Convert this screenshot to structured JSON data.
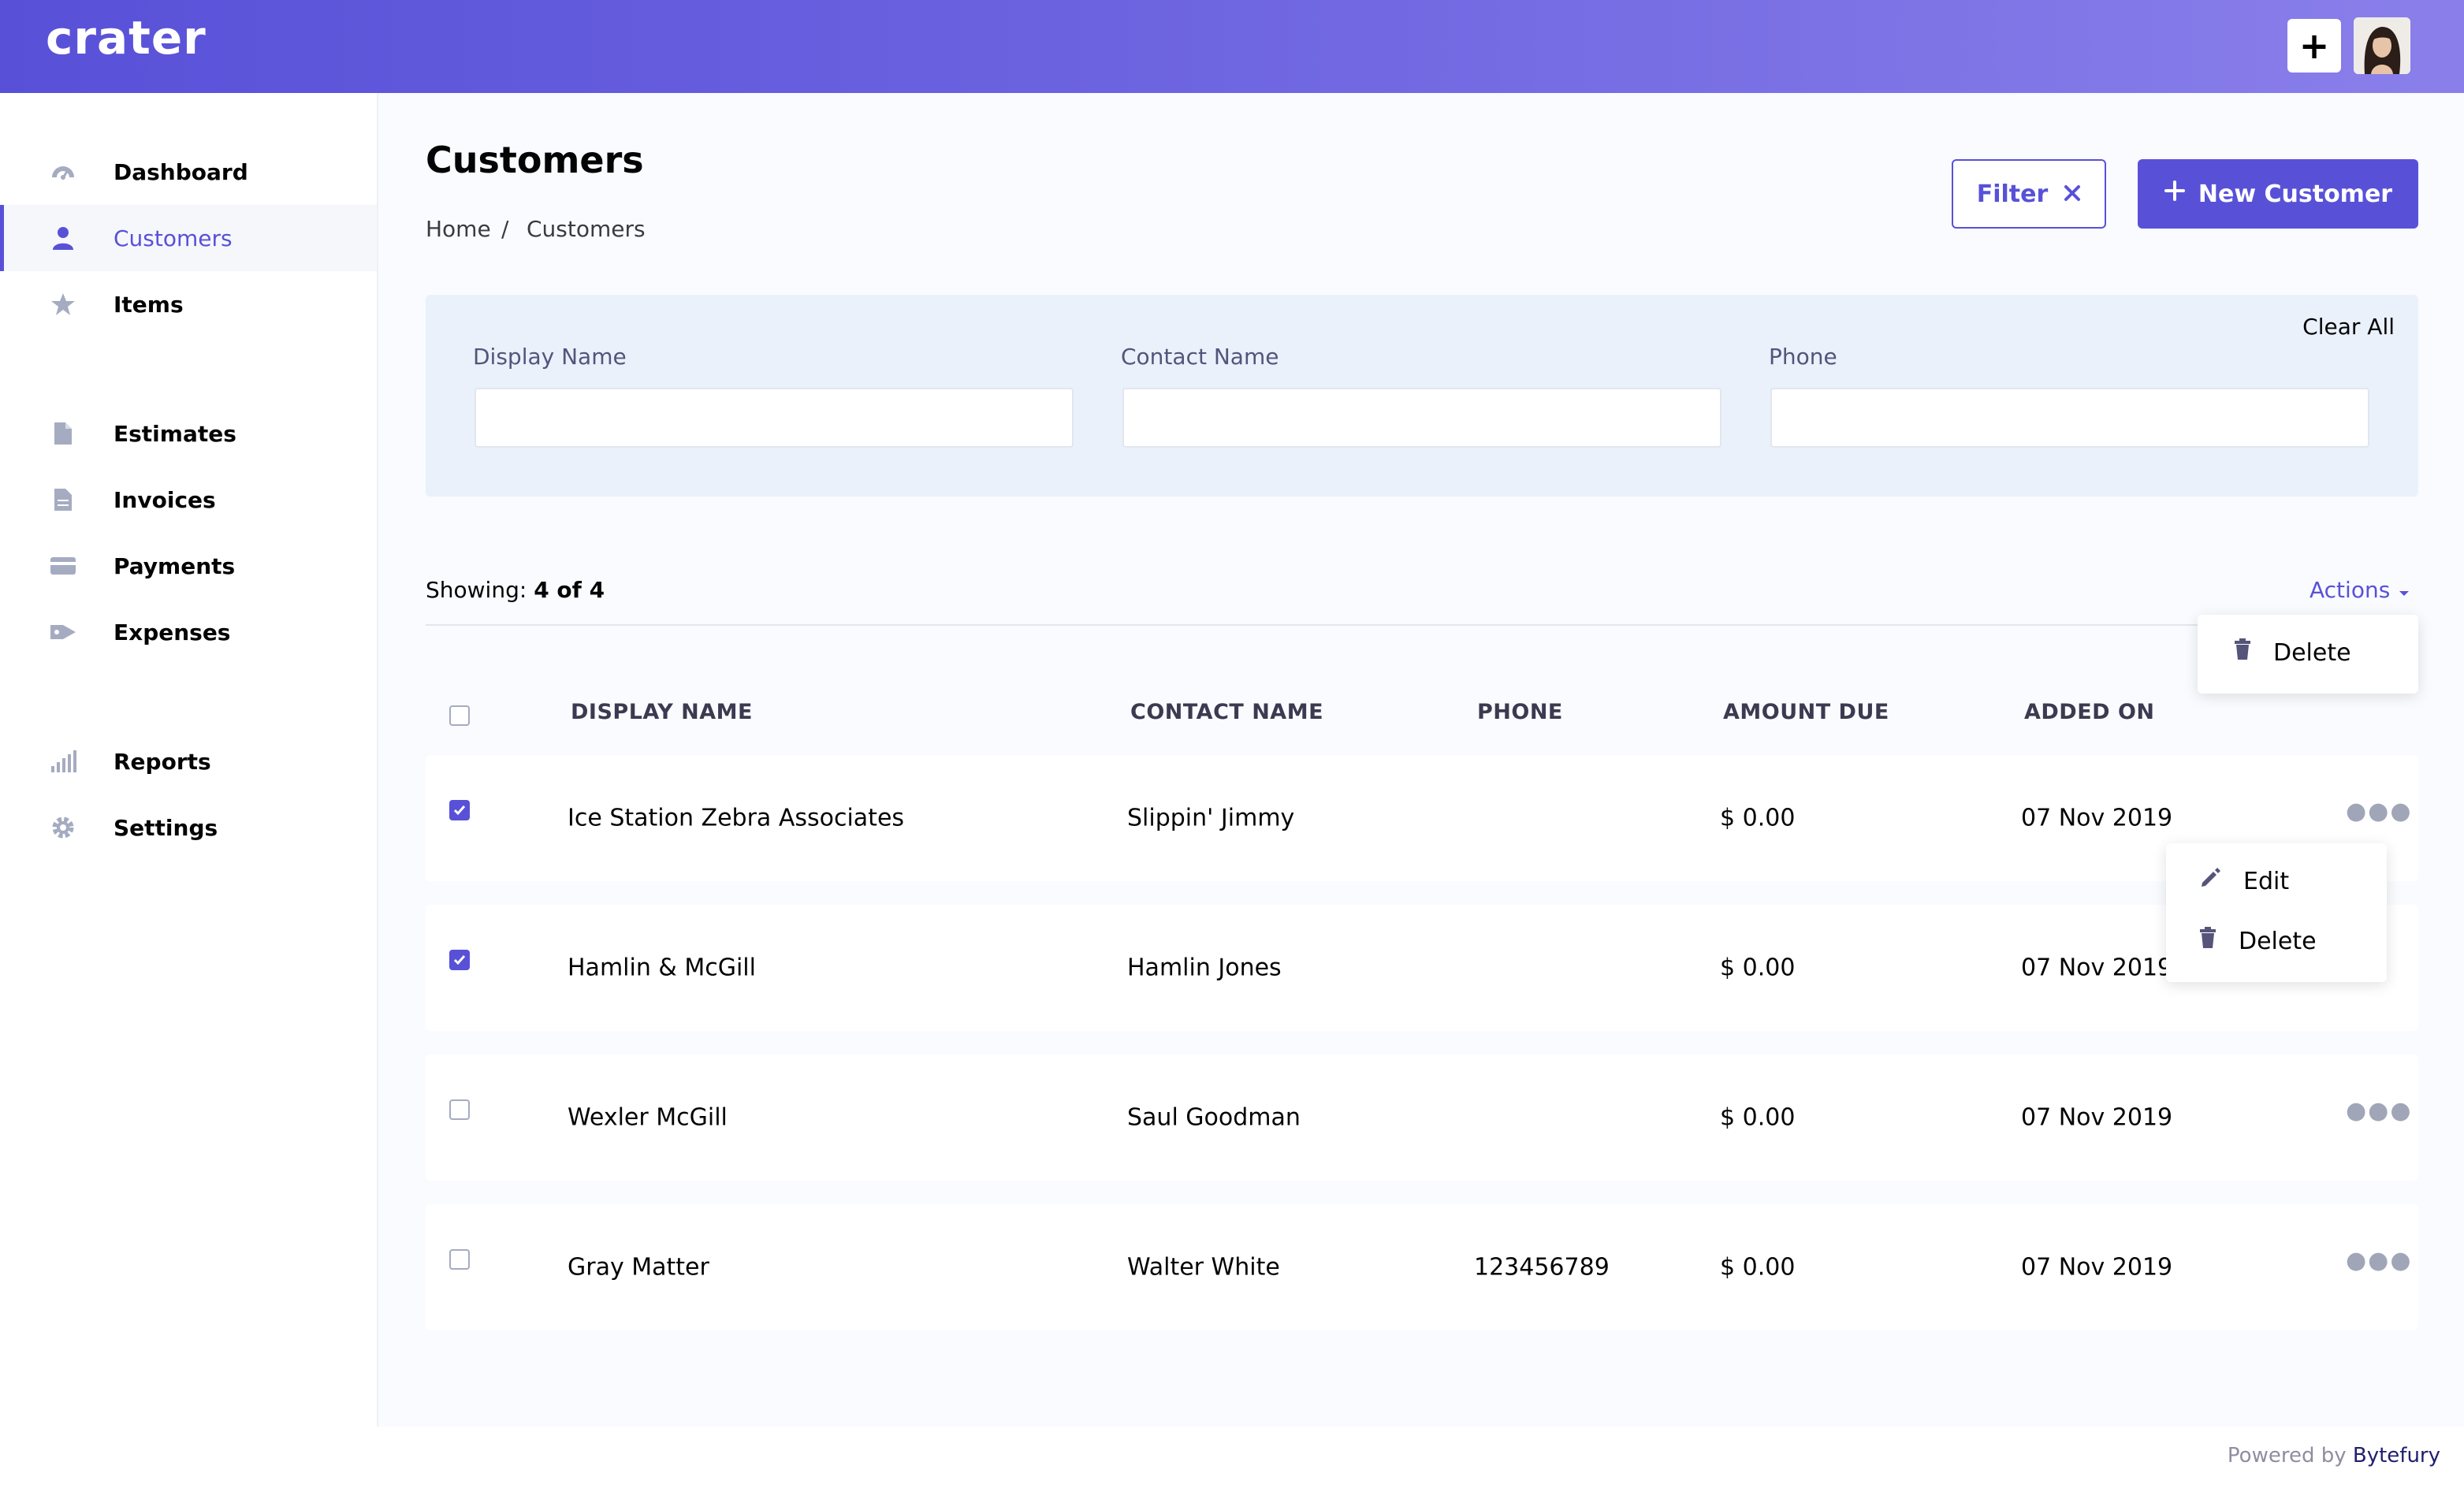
{
  "app": {
    "logo": "crater"
  },
  "header": {
    "add_icon": "plus-icon",
    "avatar": "user-avatar"
  },
  "sidebar": {
    "items": [
      {
        "label": "Dashboard",
        "icon": "dashboard-icon"
      },
      {
        "label": "Customers",
        "icon": "user-icon",
        "active": true
      },
      {
        "label": "Items",
        "icon": "star-icon"
      },
      {
        "label": "Estimates",
        "icon": "document-icon"
      },
      {
        "label": "Invoices",
        "icon": "invoice-icon"
      },
      {
        "label": "Payments",
        "icon": "credit-card-icon"
      },
      {
        "label": "Expenses",
        "icon": "expense-icon"
      },
      {
        "label": "Reports",
        "icon": "signal-bars-icon"
      },
      {
        "label": "Settings",
        "icon": "gear-icon"
      }
    ]
  },
  "page": {
    "title": "Customers",
    "breadcrumb": {
      "home": "Home",
      "separator": "/",
      "current": "Customers"
    },
    "filter_button": "Filter",
    "new_button": "New Customer"
  },
  "filters": {
    "clear_all": "Clear All",
    "fields": [
      {
        "label": "Display Name",
        "value": "",
        "placeholder": ""
      },
      {
        "label": "Contact Name",
        "value": "",
        "placeholder": ""
      },
      {
        "label": "Phone",
        "value": "",
        "placeholder": ""
      }
    ]
  },
  "summary": {
    "prefix": "Showing:",
    "count": "4 of 4"
  },
  "actions": {
    "label": "Actions",
    "menu": [
      {
        "label": "Delete",
        "icon": "trash-icon"
      }
    ]
  },
  "table": {
    "columns": [
      "DISPLAY NAME",
      "CONTACT NAME",
      "PHONE",
      "AMOUNT DUE",
      "ADDED ON"
    ],
    "rows": [
      {
        "checked": true,
        "display_name": "Ice Station Zebra Associates",
        "contact_name": "Slippin' Jimmy",
        "phone": "",
        "amount_due": "$ 0.00",
        "added_on": "07 Nov 2019"
      },
      {
        "checked": true,
        "display_name": "Hamlin & McGill",
        "contact_name": "Hamlin Jones",
        "phone": "",
        "amount_due": "$ 0.00",
        "added_on": "07 Nov 2019"
      },
      {
        "checked": false,
        "display_name": "Wexler McGill",
        "contact_name": "Saul Goodman",
        "phone": "",
        "amount_due": "$ 0.00",
        "added_on": "07 Nov 2019"
      },
      {
        "checked": false,
        "display_name": "Gray Matter",
        "contact_name": "Walter White",
        "phone": "123456789",
        "amount_due": "$ 0.00",
        "added_on": "07 Nov 2019"
      }
    ]
  },
  "row_menu": [
    {
      "label": "Edit",
      "icon": "pencil-icon"
    },
    {
      "label": "Delete",
      "icon": "trash-icon"
    }
  ],
  "footer": {
    "powered_by": "Powered by",
    "brand": "Bytefury"
  },
  "colors": {
    "accent": "#5851d8",
    "panel": "#eaf1fb"
  }
}
